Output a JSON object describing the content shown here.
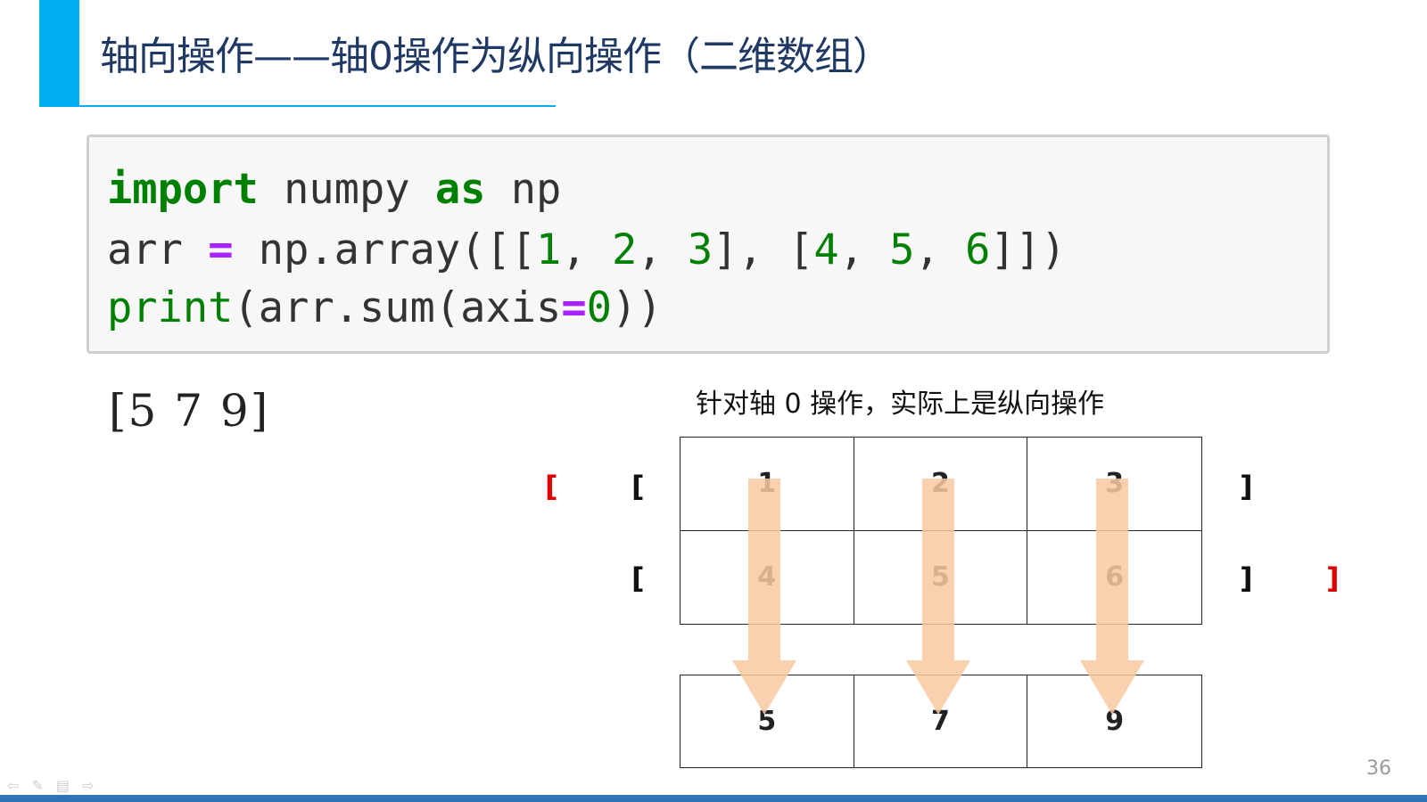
{
  "slide": {
    "title": "轴向操作——轴0操作为纵向操作（二维数组）",
    "page_number": "36"
  },
  "code": {
    "line1": {
      "kw1": "import",
      "t1": " numpy ",
      "kw2": "as",
      "t2": " np"
    },
    "line2": {
      "t1": "arr ",
      "op": "=",
      "t2": " np.array([[",
      "n1": "1",
      "c1": ", ",
      "n2": "2",
      "c2": ", ",
      "n3": "3",
      "t3": "], [",
      "n4": "4",
      "c4": ", ",
      "n5": "5",
      "c5": ", ",
      "n6": "6",
      "t4": "]])"
    },
    "line3": {
      "fn": "print",
      "t1": "(arr.sum(axis",
      "op": "=",
      "n": "0",
      "t2": "))"
    }
  },
  "output": "[5 7 9]",
  "diagram": {
    "caption": "针对轴 0 操作，实际上是纵向操作",
    "matrix": [
      [
        "1",
        "2",
        "3"
      ],
      [
        "4",
        "5",
        "6"
      ]
    ],
    "result": [
      "5",
      "7",
      "9"
    ],
    "outer_open": "[",
    "outer_close": "]",
    "row_open": "[",
    "row_close": "]",
    "arrow_color": "#f8c9a0"
  },
  "nav": {
    "prev": "⇦",
    "pen": "✎",
    "menu": "▤",
    "next": "⇨"
  },
  "colors": {
    "accent": "#00b0f0",
    "title": "#1f3864",
    "keyword": "#008000",
    "operator": "#aa22ff",
    "bracket_red": "#e00000",
    "bottom_bar": "#2e75b6"
  }
}
